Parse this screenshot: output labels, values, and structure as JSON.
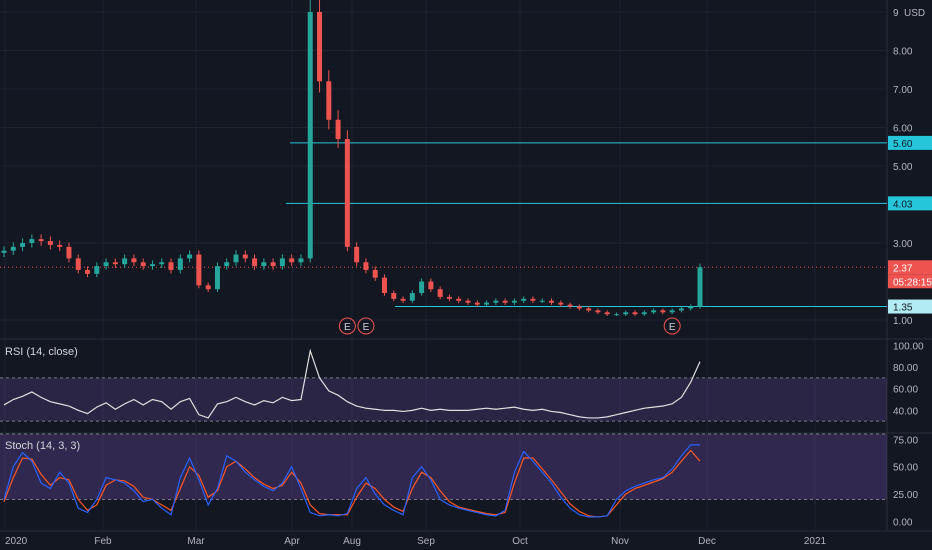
{
  "price_axis": {
    "currency": "USD",
    "ticks": [
      "9",
      "8.00",
      "7.00",
      "6.00",
      "5.00",
      "3.00",
      "1.00"
    ],
    "badges": [
      {
        "text": "5.60",
        "color": "#26c6da",
        "price": 5.6
      },
      {
        "text": "4.03",
        "color": "#26c6da",
        "price": 4.03
      },
      {
        "text": "2.37",
        "color": "#ef5350",
        "price": 2.37
      },
      {
        "text": "05:28:15",
        "color": "#ef5350",
        "price": 2.37
      },
      {
        "text": "1.35",
        "color": "#b2ebf2",
        "price": 1.35
      }
    ]
  },
  "rsi_pane": {
    "label": "RSI (14, close)",
    "ticks": [
      "100.00",
      "80.00",
      "60.00",
      "40.00"
    ]
  },
  "stoch_pane": {
    "label": "Stoch (14, 3, 3)",
    "ticks": [
      "75.00",
      "50.00",
      "25.00",
      "0.00"
    ]
  },
  "time_axis": {
    "labels": [
      "2020",
      "Feb",
      "Mar",
      "Apr",
      "Aug",
      "Sep",
      "Oct",
      "Nov",
      "Dec",
      "2021"
    ]
  },
  "colors": {
    "up": "#26a69a",
    "down": "#ef5350",
    "level_line": "#26c6da",
    "rsi_line": "#e0e0e0",
    "rsi_band": "#7e57c2",
    "stoch_k": "#2962ff",
    "stoch_d": "#ff5722",
    "stoch_band": "#7e57c2"
  },
  "chart_data": {
    "type": "candlestick",
    "price_ylim": [
      0.5,
      9.3
    ],
    "earnings_markers": [
      {
        "label": "E",
        "x_index": 37
      },
      {
        "label": "E",
        "x_index": 39
      },
      {
        "label": "E",
        "x_index": 72
      }
    ],
    "horizontal_levels": [
      5.6,
      4.03,
      1.35
    ],
    "current_price": 2.37,
    "series": [
      {
        "name": "price",
        "values": [
          2.8,
          2.9,
          3.0,
          3.1,
          3.05,
          2.95,
          2.9,
          2.6,
          2.3,
          2.2,
          2.4,
          2.5,
          2.45,
          2.6,
          2.5,
          2.4,
          2.45,
          2.5,
          2.3,
          2.6,
          2.7,
          1.9,
          1.8,
          2.4,
          2.5,
          2.7,
          2.6,
          2.4,
          2.5,
          2.4,
          2.6,
          2.5,
          2.6,
          9.0,
          7.2,
          6.2,
          5.7,
          2.9,
          2.5,
          2.3,
          2.1,
          1.7,
          1.55,
          1.5,
          1.7,
          2.0,
          1.8,
          1.6,
          1.55,
          1.5,
          1.45,
          1.4,
          1.45,
          1.5,
          1.45,
          1.5,
          1.55,
          1.5,
          1.5,
          1.45,
          1.4,
          1.35,
          1.3,
          1.25,
          1.2,
          1.15,
          1.15,
          1.2,
          1.15,
          1.2,
          1.25,
          1.2,
          1.25,
          1.3,
          1.35,
          2.37
        ]
      },
      {
        "name": "RSI",
        "values": [
          45,
          50,
          53,
          57,
          52,
          48,
          46,
          44,
          40,
          37,
          43,
          47,
          41,
          46,
          50,
          45,
          50,
          48,
          41,
          48,
          51,
          36,
          33,
          46,
          48,
          52,
          48,
          45,
          49,
          47,
          52,
          49,
          50,
          95,
          70,
          58,
          54,
          48,
          44,
          42,
          41,
          40,
          40,
          39,
          40,
          42,
          40,
          41,
          40,
          40,
          40,
          41,
          42,
          41,
          42,
          43,
          41,
          40,
          41,
          39,
          38,
          36,
          34,
          33,
          33,
          34,
          36,
          38,
          40,
          42,
          43,
          44,
          46,
          52,
          66,
          85
        ]
      },
      {
        "name": "%K",
        "values": [
          20,
          50,
          63,
          55,
          35,
          30,
          45,
          35,
          12,
          8,
          20,
          40,
          38,
          35,
          28,
          18,
          20,
          12,
          6,
          40,
          58,
          38,
          15,
          30,
          60,
          55,
          45,
          38,
          32,
          28,
          35,
          50,
          30,
          8,
          5,
          6,
          5,
          7,
          30,
          40,
          25,
          15,
          10,
          6,
          40,
          50,
          38,
          20,
          15,
          12,
          10,
          8,
          6,
          5,
          10,
          45,
          64,
          55,
          45,
          35,
          22,
          12,
          6,
          4,
          4,
          5,
          20,
          28,
          32,
          35,
          38,
          40,
          48,
          60,
          70,
          70
        ]
      },
      {
        "name": "%D",
        "values": [
          18,
          40,
          58,
          57,
          43,
          33,
          40,
          38,
          20,
          10,
          15,
          33,
          38,
          37,
          32,
          22,
          20,
          15,
          10,
          30,
          50,
          42,
          22,
          28,
          50,
          55,
          48,
          40,
          34,
          30,
          33,
          45,
          35,
          15,
          7,
          6,
          6,
          6,
          22,
          35,
          30,
          20,
          13,
          9,
          30,
          45,
          40,
          28,
          18,
          13,
          11,
          9,
          7,
          6,
          8,
          35,
          58,
          58,
          48,
          38,
          27,
          16,
          9,
          5,
          4,
          5,
          15,
          25,
          30,
          33,
          36,
          39,
          45,
          55,
          65,
          55
        ]
      }
    ],
    "rsi_ylim": [
      20,
      105
    ],
    "stoch_ylim": [
      -8,
      80
    ],
    "rsi_band": [
      30,
      70
    ],
    "stoch_band": [
      20,
      80
    ]
  }
}
